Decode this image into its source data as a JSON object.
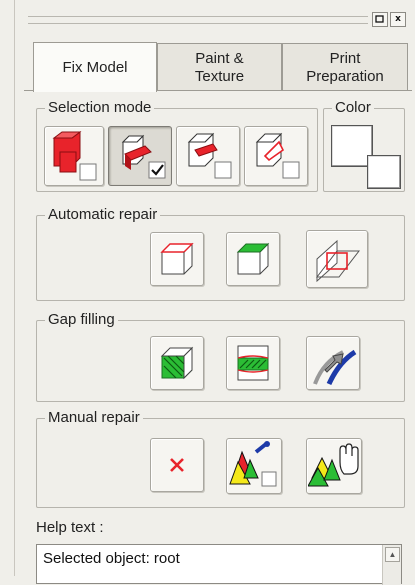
{
  "titlebar": {
    "pin_label": "",
    "close_label": "x"
  },
  "tabs": [
    {
      "label": "Fix Model",
      "active": true
    },
    {
      "label": "Paint &\nTexture",
      "active": false
    },
    {
      "label": "Print\nPreparation",
      "active": false
    }
  ],
  "groups": {
    "selection_mode": {
      "label": "Selection mode",
      "selected_index": 1
    },
    "color": {
      "label": "Color"
    },
    "automatic_repair": {
      "label": "Automatic repair"
    },
    "gap_filling": {
      "label": "Gap filling"
    },
    "manual_repair": {
      "label": "Manual repair"
    }
  },
  "help": {
    "label": "Help text :",
    "text": "Selected object: root"
  },
  "colors": {
    "red": "#e8232b",
    "green": "#2bbd35",
    "yellow": "#f4e81a",
    "blue": "#1d3aa8",
    "panel": "#f0efea"
  }
}
